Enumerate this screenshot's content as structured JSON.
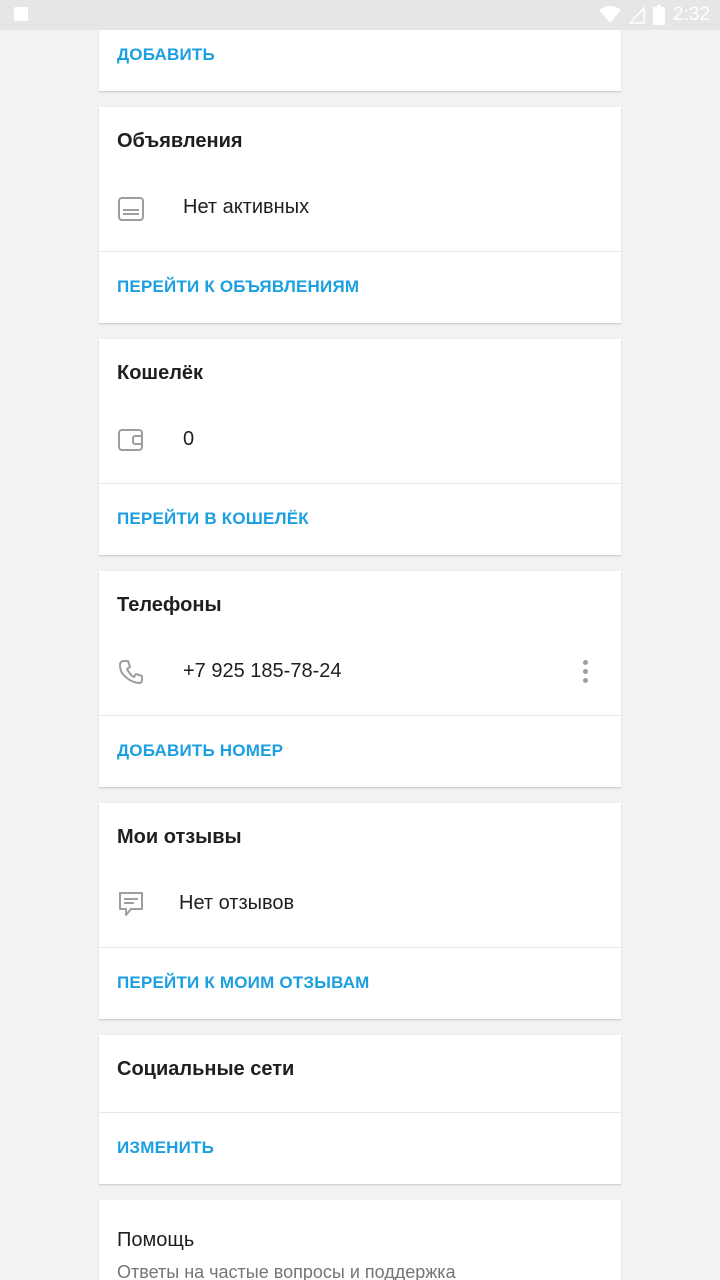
{
  "status_bar": {
    "time": "2:32"
  },
  "top_card": {
    "action": "ДОБАВИТЬ"
  },
  "ads": {
    "title": "Объявления",
    "value": "Нет активных",
    "action": "ПЕРЕЙТИ К ОБЪЯВЛЕНИЯМ"
  },
  "wallet": {
    "title": "Кошелёк",
    "value": "0",
    "action": "ПЕРЕЙТИ В КОШЕЛЁК"
  },
  "phones": {
    "title": "Телефоны",
    "value": "+7 925 185-78-24",
    "action": "ДОБАВИТЬ НОМЕР"
  },
  "reviews": {
    "title": "Мои отзывы",
    "value": "Нет отзывов",
    "action": "ПЕРЕЙТИ К МОИМ ОТЗЫВАМ"
  },
  "social": {
    "title": "Социальные сети",
    "action": "ИЗМЕНИТЬ"
  },
  "help": {
    "title": "Помощь",
    "subtitle": "Ответы на частые вопросы и поддержка"
  },
  "colors": {
    "accent": "#1a9fe0",
    "background": "#f2f2f2",
    "card": "#ffffff",
    "icon": "#9e9e9e"
  }
}
